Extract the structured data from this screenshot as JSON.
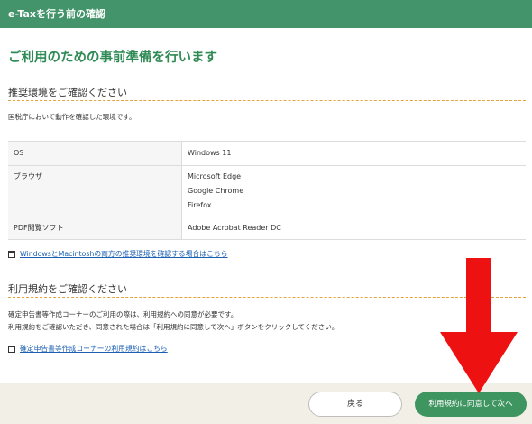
{
  "header": {
    "title": "e-Taxを行う前の確認"
  },
  "page_title": "ご利用のための事前準備を行います",
  "env_section": {
    "heading": "推奨環境をご確認ください",
    "description": "国税庁において動作を確認した環境です。",
    "rows": [
      {
        "label": "OS",
        "values": [
          "Windows 11"
        ]
      },
      {
        "label": "ブラウザ",
        "values": [
          "Microsoft Edge",
          "Google Chrome",
          "Firefox"
        ]
      },
      {
        "label": "PDF閲覧ソフト",
        "values": [
          "Adobe Acrobat Reader DC"
        ]
      }
    ],
    "link": "WindowsとMacintoshの両方の推奨環境を確認する場合はこちら"
  },
  "terms_section": {
    "heading": "利用規約をご確認ください",
    "description_lines": [
      "確定申告書等作成コーナーのご利用の際は、利用規約への同意が必要です。",
      "利用規約をご確認いただき、同意された場合は「利用規約に同意して次へ」ボタンをクリックしてください。"
    ],
    "link": "確定申告書等作成コーナーの利用規約はこちら"
  },
  "footer": {
    "back_label": "戻る",
    "next_label": "利用規約に同意して次へ"
  },
  "colors": {
    "header_bg": "#43946a",
    "title": "#2f8a55",
    "accent_divider": "#e3a23a",
    "link": "#1a5fb4",
    "next_button": "#3f9560",
    "annotation_arrow": "#ee1111"
  },
  "icons": {
    "link": "external-window-icon",
    "annotation": "red-down-arrow"
  }
}
